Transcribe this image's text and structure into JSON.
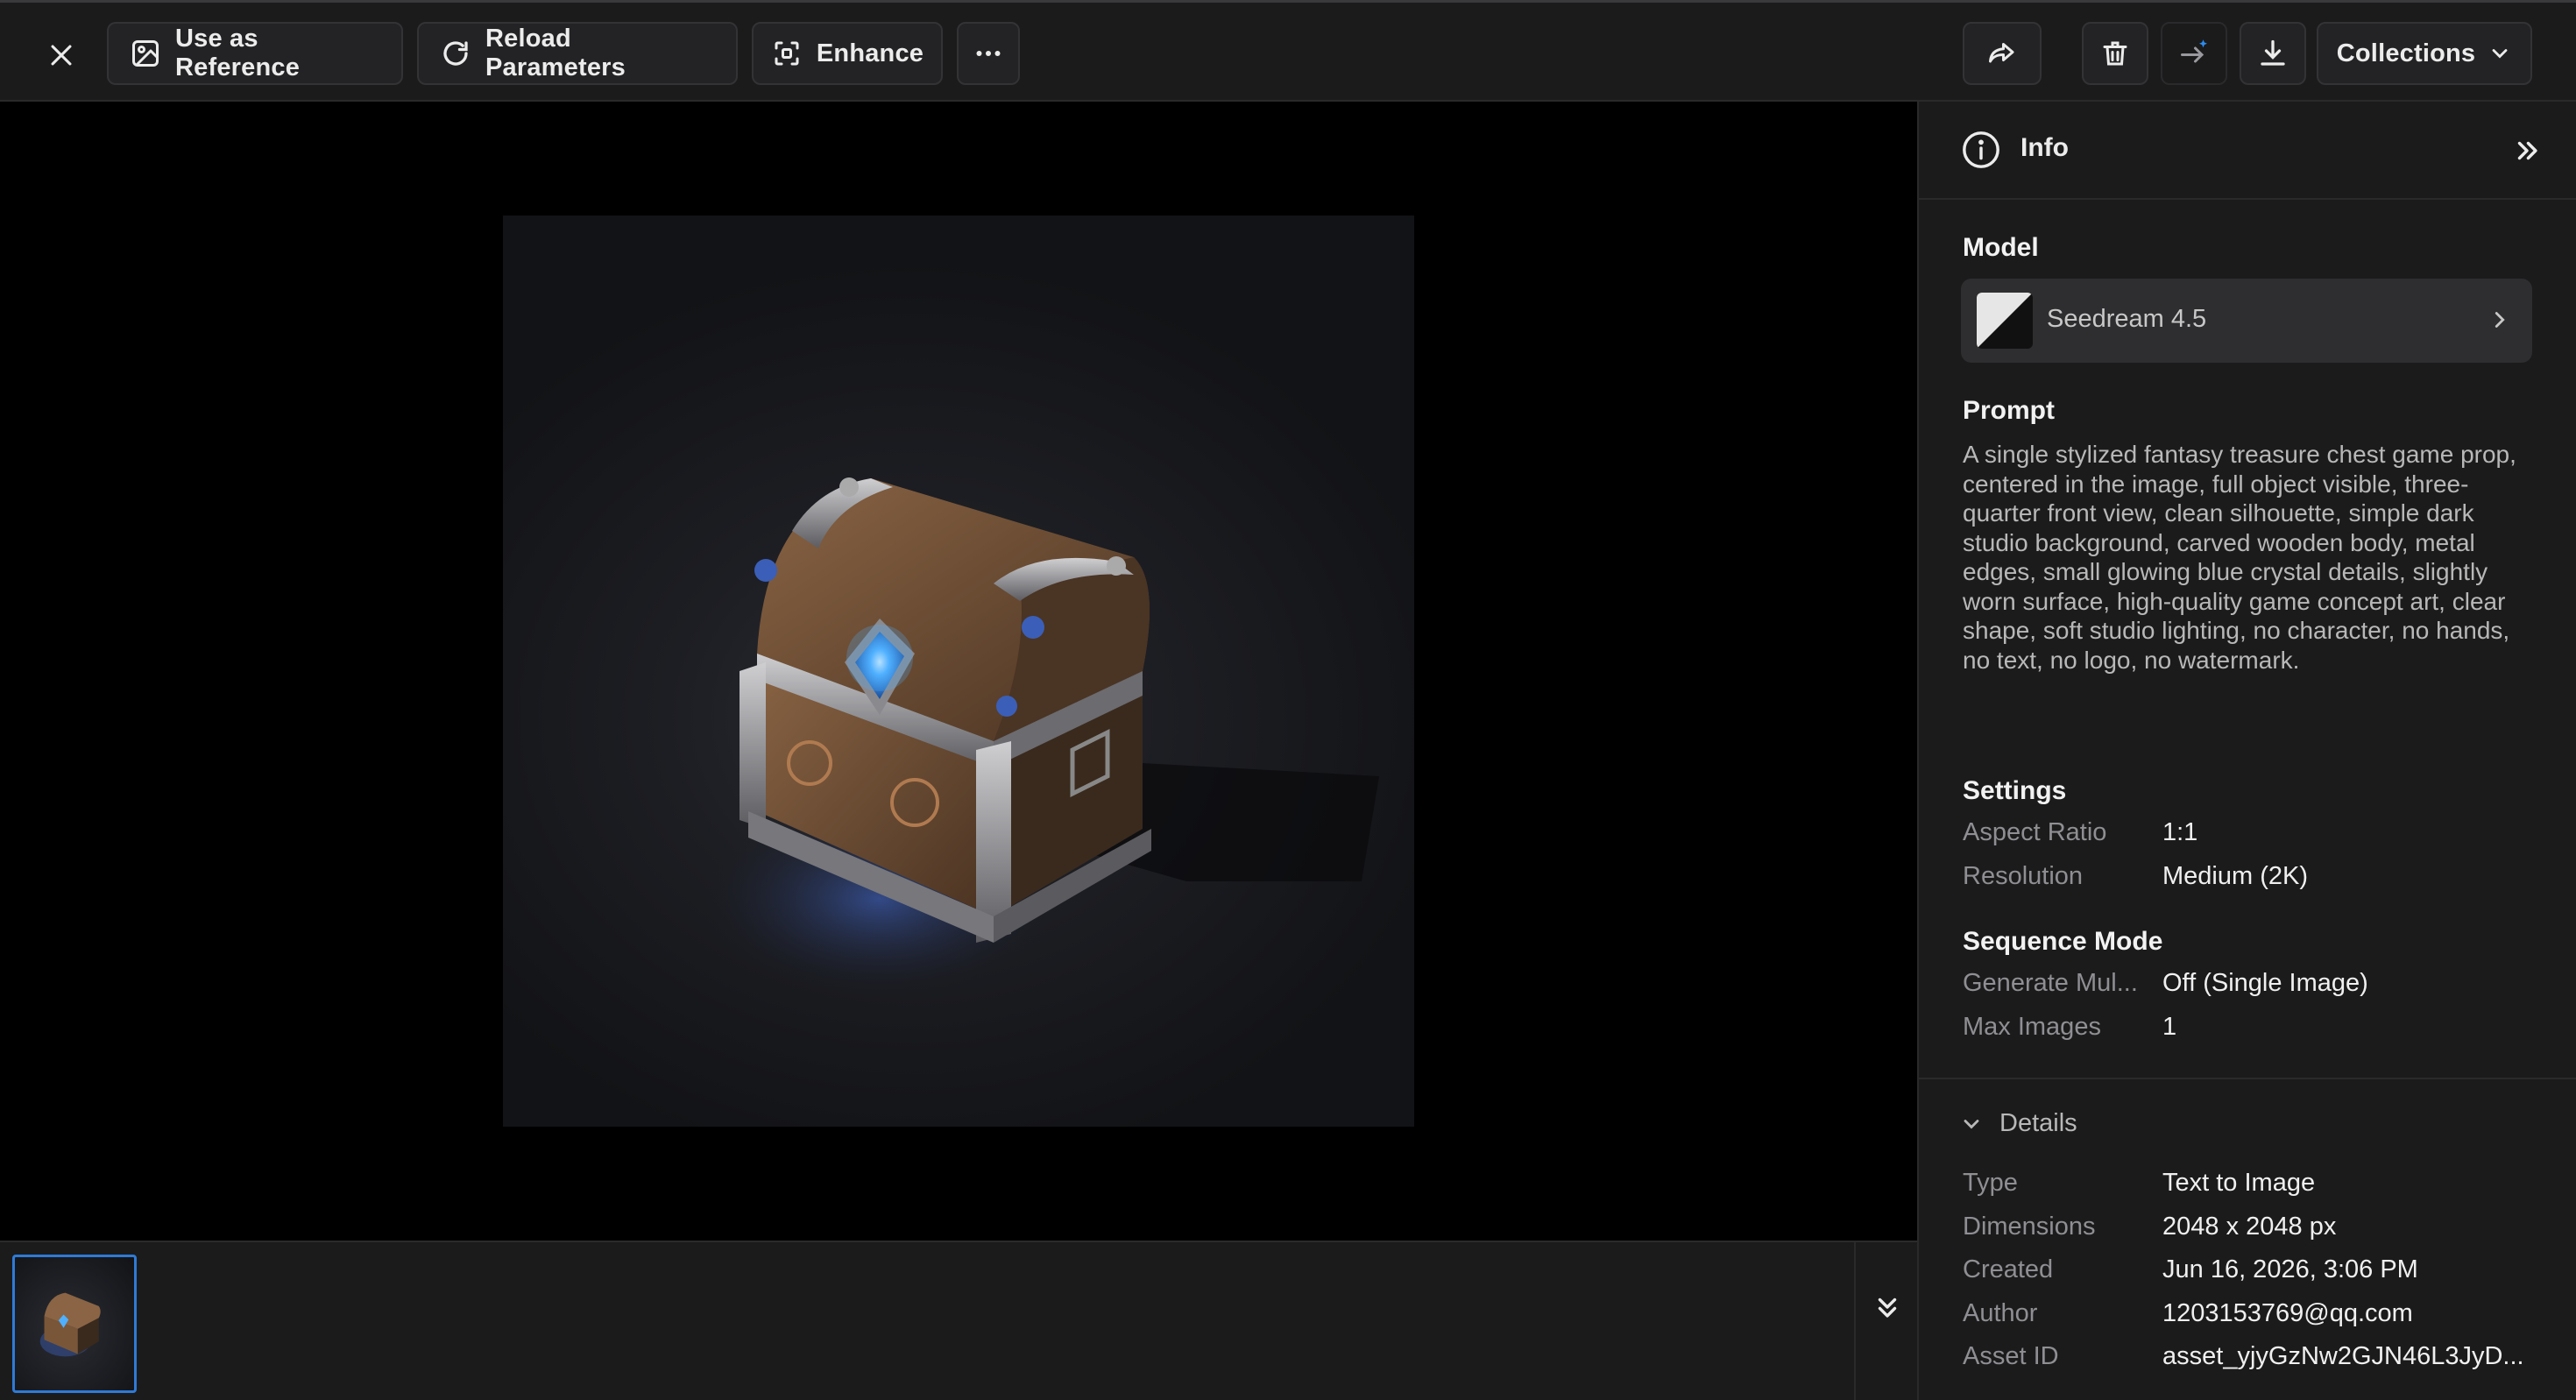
{
  "toolbar": {
    "use_as_reference": "Use as Reference",
    "reload_parameters": "Reload Parameters",
    "enhance": "Enhance",
    "collections": "Collections"
  },
  "panel": {
    "title": "Info",
    "model_section": "Model",
    "model_name": "Seedream 4.5",
    "prompt_section": "Prompt",
    "prompt_text": "A single stylized fantasy treasure chest game prop, centered in the image, full object visible, three-quarter front view, clean silhouette, simple dark studio background, carved wooden body, metal edges, small glowing blue crystal details, slightly worn surface, high-quality game concept art, clear shape, soft studio lighting, no character, no hands, no text, no logo, no watermark.",
    "settings_section": "Settings",
    "settings": [
      {
        "label": "Aspect Ratio",
        "value": "1:1"
      },
      {
        "label": "Resolution",
        "value": "Medium (2K)"
      }
    ],
    "sequence_section": "Sequence Mode",
    "sequence": [
      {
        "label": "Generate Mul...",
        "value": "Off (Single Image)"
      },
      {
        "label": "Max Images",
        "value": "1"
      }
    ],
    "details_section": "Details",
    "details": [
      {
        "label": "Type",
        "value": "Text to Image"
      },
      {
        "label": "Dimensions",
        "value": "2048 x 2048 px"
      },
      {
        "label": "Created",
        "value": "Jun 16, 2026, 3:06 PM"
      },
      {
        "label": "Author",
        "value": "1203153769@qq.com"
      },
      {
        "label": "Asset ID",
        "value": "asset_yjyGzNw2GJN46L3JyD..."
      }
    ]
  },
  "icons": {
    "close": "close-icon",
    "image": "image-icon",
    "reload": "reload-icon",
    "enhance": "enhance-icon",
    "more": "more-icon",
    "share": "share-icon",
    "trash": "trash-icon",
    "send": "send-sparkle-icon",
    "download": "download-icon",
    "chevron": "chevron-down-icon",
    "info": "info-icon",
    "expand": "chevrons-right-icon",
    "collapse": "chevrons-down-icon"
  },
  "colors": {
    "accent": "#2f7ad6",
    "sparkle": "#2c8cf0",
    "crystal": "#4fb0ff"
  }
}
